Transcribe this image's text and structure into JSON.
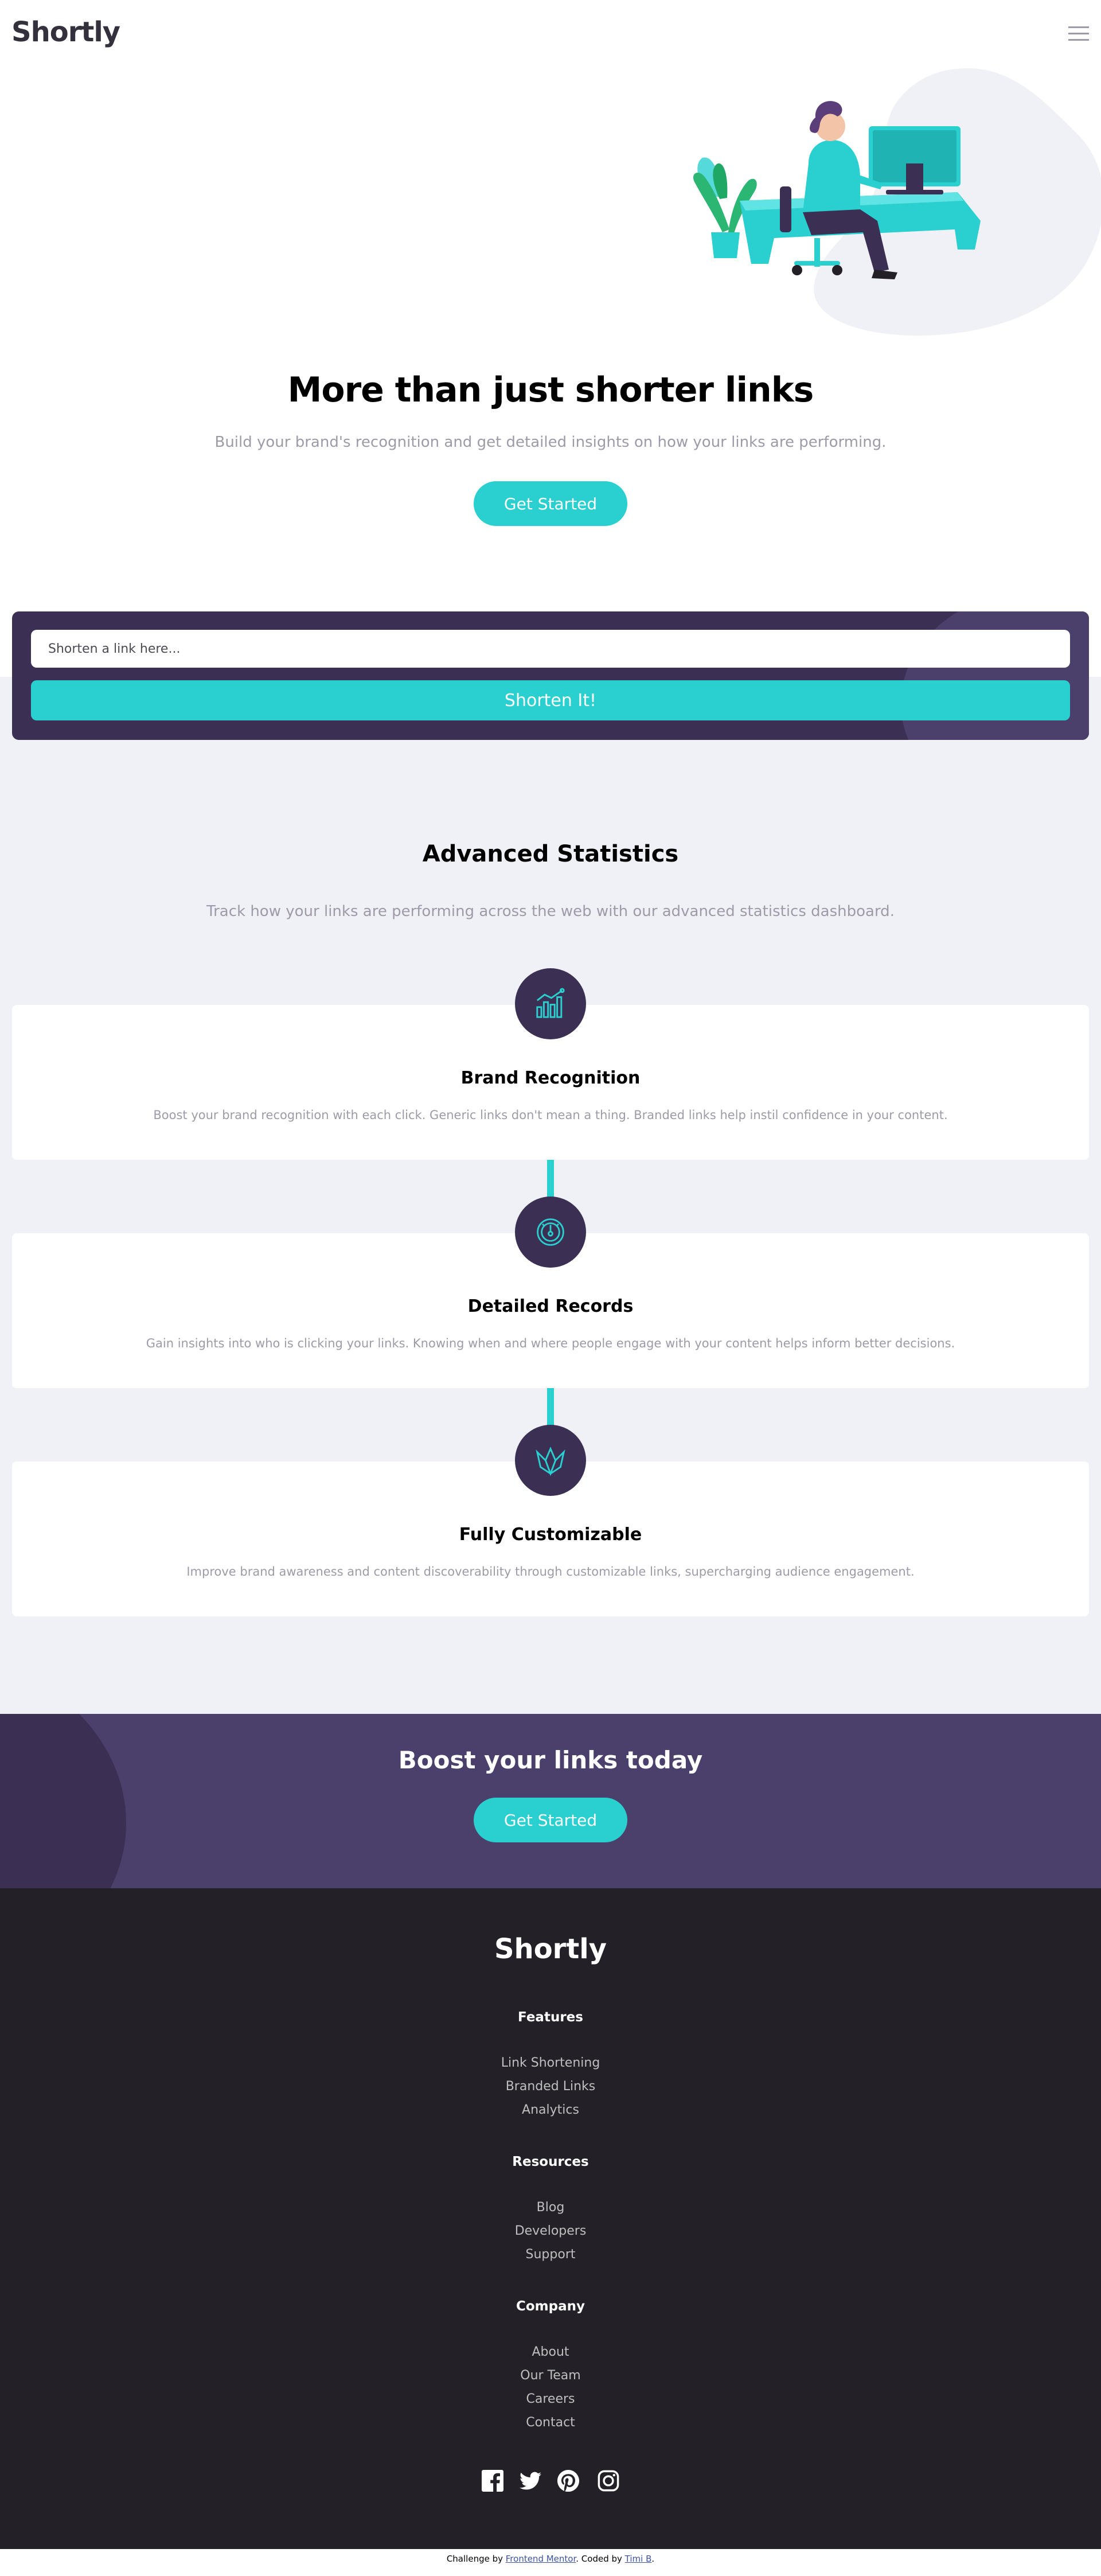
{
  "header": {
    "logo": "Shortly",
    "menu_icon": "hamburger-menu-icon"
  },
  "hero": {
    "title": "More than just shorter links",
    "subtitle": "Build your brand's recognition and get detailed insights on how your links are performing.",
    "cta_label": "Get Started",
    "illustration": "person-working-illustration"
  },
  "shorten": {
    "placeholder": "Shorten a link here...",
    "button_label": "Shorten It!"
  },
  "stats": {
    "title": "Advanced Statistics",
    "subtitle": "Track how your links are performing across the web with our advanced statistics dashboard.",
    "cards": [
      {
        "icon": "brand-recognition-icon",
        "title": "Brand Recognition",
        "text": "Boost your brand recognition with each click. Generic links don't mean a thing. Branded links help instil confidence in your content."
      },
      {
        "icon": "detailed-records-icon",
        "title": "Detailed Records",
        "text": "Gain insights into who is clicking your links. Knowing when and where people engage with your content helps inform better decisions."
      },
      {
        "icon": "fully-customizable-icon",
        "title": "Fully Customizable",
        "text": "Improve brand awareness and content discoverability through customizable links, supercharging audience engagement."
      }
    ]
  },
  "boost": {
    "title": "Boost your links today",
    "cta_label": "Get Started"
  },
  "footer": {
    "logo": "Shortly",
    "features": {
      "heading": "Features",
      "links": [
        "Link Shortening",
        "Branded Links",
        "Analytics"
      ]
    },
    "resources": {
      "heading": "Resources",
      "links": [
        "Blog",
        "Developers",
        "Support"
      ]
    },
    "company": {
      "heading": "Company",
      "links": [
        "About",
        "Our Team",
        "Careers",
        "Contact"
      ]
    },
    "social": [
      "facebook-icon",
      "twitter-icon",
      "pinterest-icon",
      "instagram-icon"
    ]
  },
  "attribution": {
    "prefix": "Challenge by ",
    "challenge_link": "Frontend Mentor",
    "middle": ". Coded by ",
    "author_link": "Timi B",
    "suffix": "."
  },
  "colors": {
    "cyan": "#2acfcf",
    "dark_violet": "#3b3054",
    "grayish_violet": "#9e9aa8",
    "very_dark_violet": "#232127",
    "light_gray_bg": "#eff1f7",
    "boost_violet": "#4b3f6b"
  }
}
